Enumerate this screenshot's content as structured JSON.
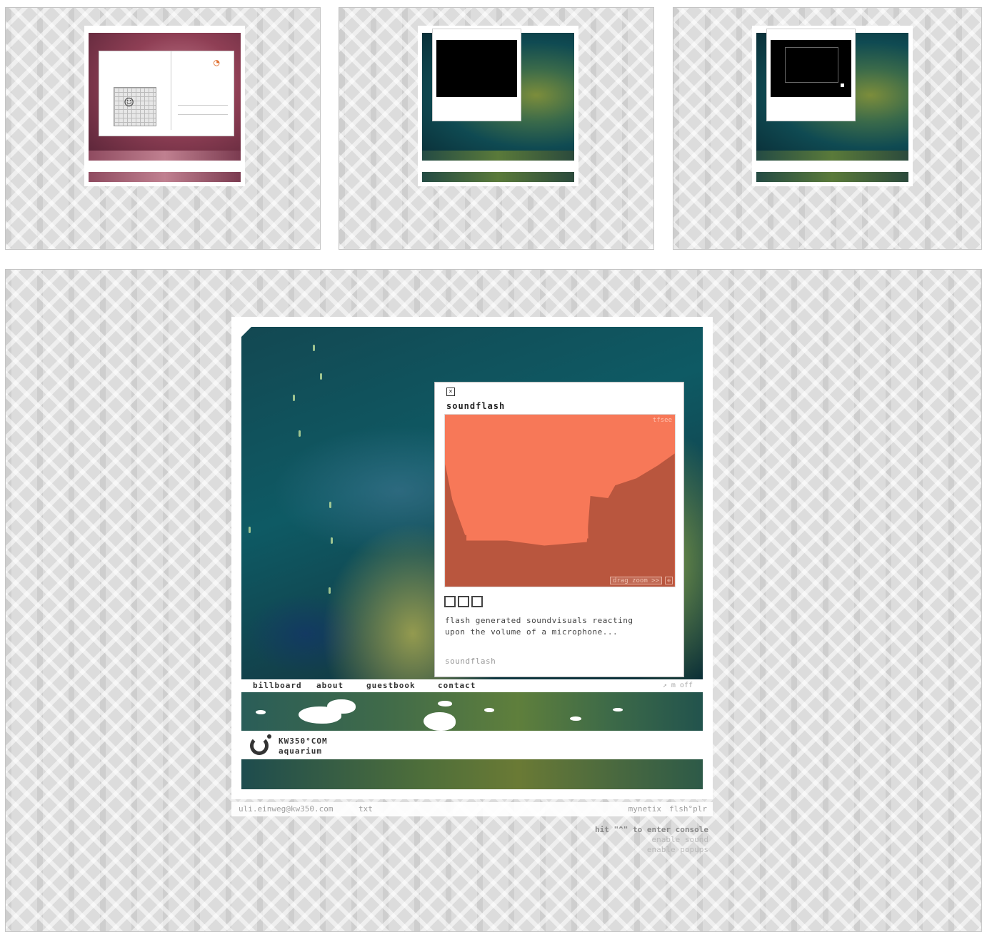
{
  "thumbnails": {
    "thumb1": {
      "theme": "face editor"
    },
    "thumb2": {
      "theme": "black screen"
    },
    "thumb3": {
      "theme": "black screen with frame"
    }
  },
  "popup": {
    "close_label": "×",
    "title": "soundflash",
    "corner_label": "tfsee",
    "zoom_label": "drag zoom >>",
    "zoom_icon": "⊕",
    "description_line1": "flash generated soundvisuals reacting",
    "description_line2": "upon the volume of a microphone...",
    "link": "soundflash",
    "colors": {
      "canvas": "#f77858",
      "shade": "#b9563e"
    }
  },
  "nav": {
    "items": [
      "billboard",
      "about",
      "guestbook",
      "contact"
    ],
    "right": "↗ m off"
  },
  "logo": {
    "name": "KW350°COM",
    "sub": "aquarium"
  },
  "footer": {
    "email": "uli.einweg@kw350.com",
    "txt": "txt",
    "mynetix": "mynetix",
    "flsh": "flsh°plr"
  },
  "console": {
    "hit": "hit \"^\" to enter console",
    "sound": "enable sound",
    "popups": "enable popups"
  }
}
